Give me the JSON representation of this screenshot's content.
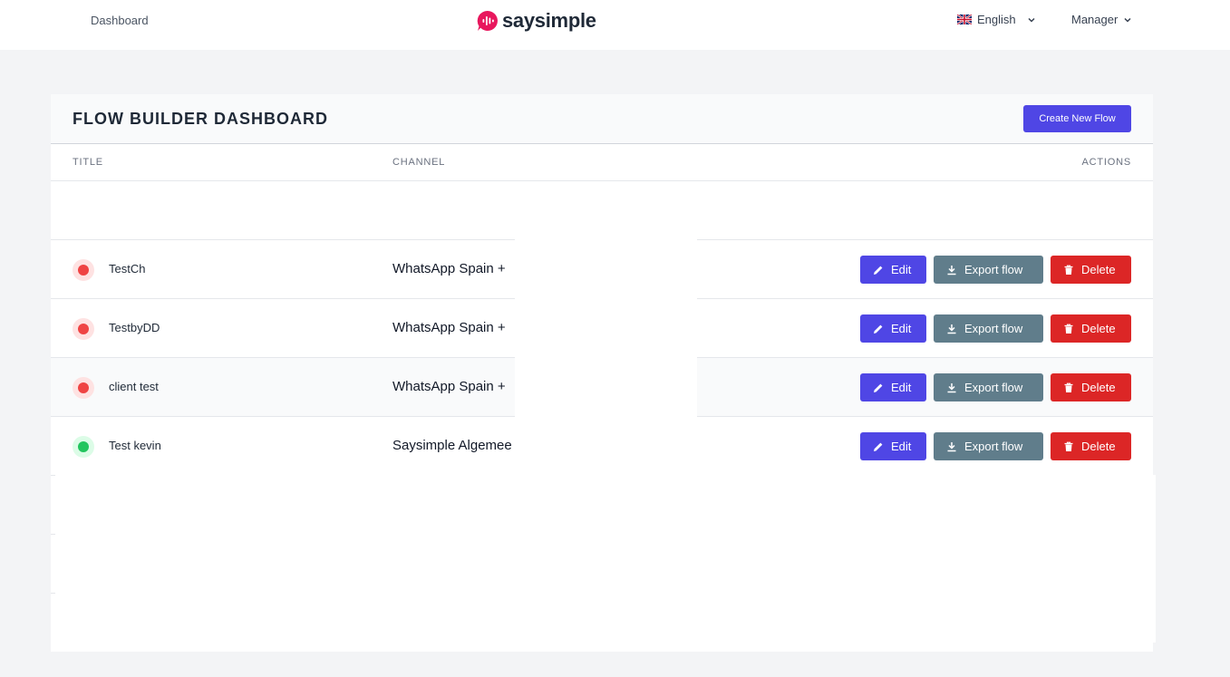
{
  "header": {
    "nav_dashboard": "Dashboard",
    "logo_text": "saysimple",
    "language": "English",
    "user_menu": "Manager"
  },
  "card": {
    "title": "FLOW BUILDER DASHBOARD",
    "create_button": "Create New Flow",
    "columns": {
      "title": "TITLE",
      "channel": "CHANNEL",
      "actions": "ACTIONS"
    },
    "rows": [
      {
        "title": "TestCh",
        "channel": "WhatsApp Spain +",
        "status": "inactive"
      },
      {
        "title": "TestbyDD",
        "channel": "WhatsApp Spain +",
        "status": "inactive"
      },
      {
        "title": "client test",
        "channel": "WhatsApp Spain +",
        "status": "inactive"
      },
      {
        "title": "Test kevin",
        "channel": "Saysimple Algemee",
        "status": "active"
      }
    ],
    "actions": {
      "edit": "Edit",
      "export": "Export flow",
      "delete": "Delete"
    }
  },
  "colors": {
    "primary": "#4f46e5",
    "export": "#607d8b",
    "danger": "#dc2626",
    "brand": "#e8175d"
  }
}
